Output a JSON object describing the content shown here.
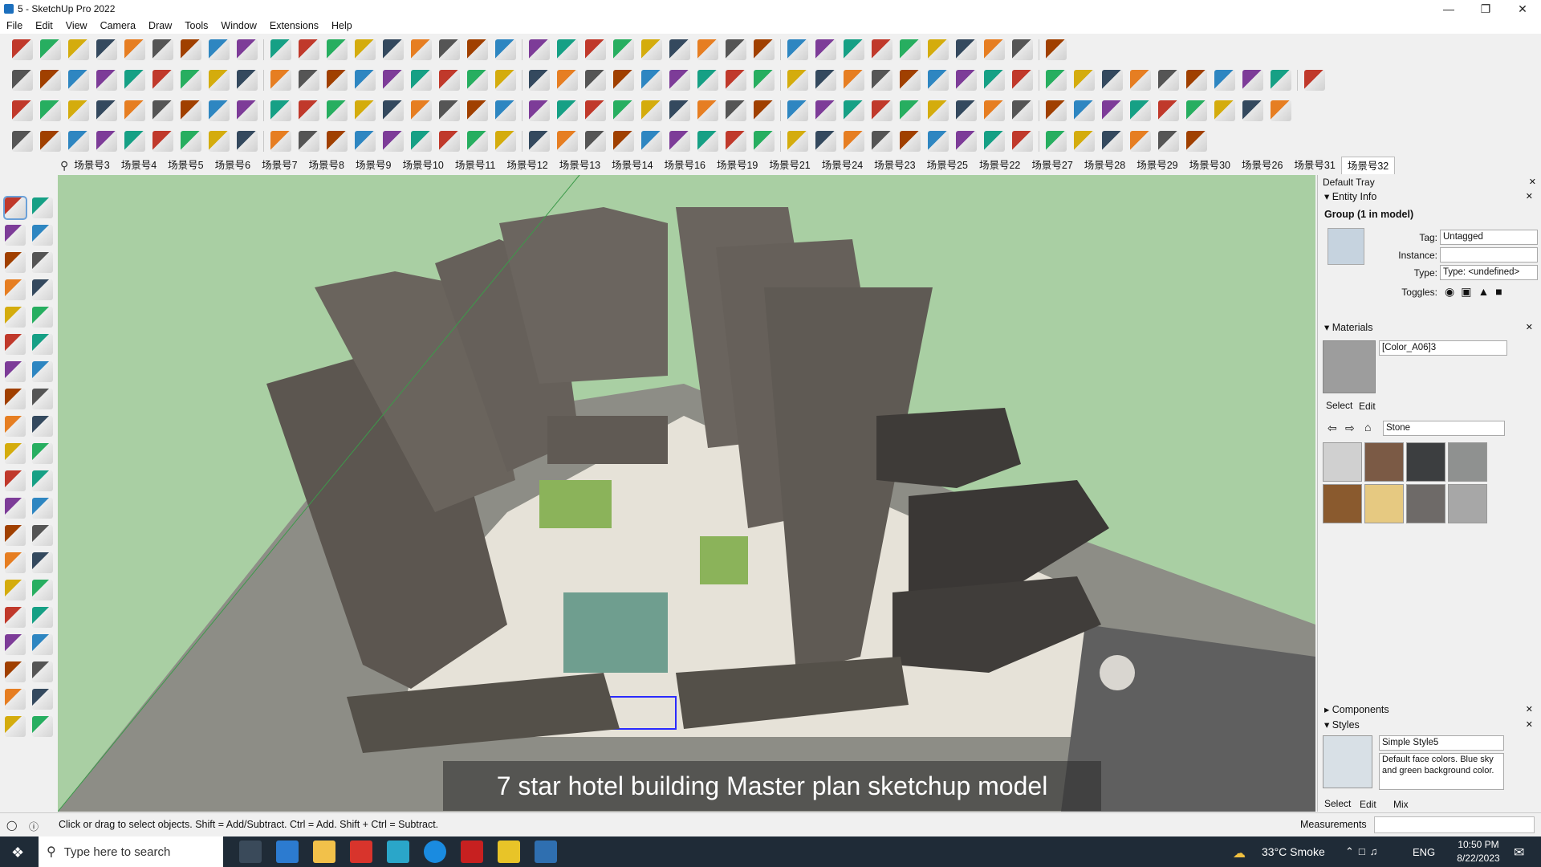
{
  "window": {
    "title": "5 - SketchUp Pro 2022",
    "controls": [
      "minimize-icon",
      "restore-icon",
      "close-icon"
    ]
  },
  "menu": [
    "File",
    "Edit",
    "View",
    "Camera",
    "Draw",
    "Tools",
    "Window",
    "Extensions",
    "Help"
  ],
  "scenes": {
    "tabs": [
      "场景号3",
      "场景号4",
      "场景号5",
      "场景号6",
      "场景号7",
      "场景号8",
      "场景号9",
      "场景号10",
      "场景号11",
      "场景号12",
      "场景号13",
      "场景号14",
      "场景号16",
      "场景号19",
      "场景号21",
      "场景号24",
      "场景号23",
      "场景号25",
      "场景号22",
      "场景号27",
      "场景号28",
      "场景号29",
      "场景号30",
      "场景号26",
      "场景号31",
      "场景号32"
    ],
    "active": "场景号32"
  },
  "viewport": {
    "caption": "7 star hotel building Master plan sketchup model",
    "background_color": "#a9cfa3"
  },
  "tray": {
    "title": "Default Tray",
    "entity_info": {
      "section": "Entity Info",
      "heading": "Group (1 in model)",
      "tag_label": "Tag:",
      "tag_value": "Untagged",
      "instance_label": "Instance:",
      "instance_value": "",
      "type_label": "Type:",
      "type_value": "Type: <undefined>",
      "toggles_label": "Toggles:"
    },
    "materials": {
      "section": "Materials",
      "name": "[Color_A06]3",
      "tabs": [
        "Select",
        "Edit"
      ],
      "library": "Stone",
      "swatch_colors": [
        "#d0d0d0",
        "#7b5a45",
        "#3c3e40",
        "#8f9190",
        "#8a5a2e",
        "#e6c981",
        "#6e6a68",
        "#a7a7a7"
      ]
    },
    "components": {
      "section": "Components"
    },
    "styles": {
      "section": "Styles",
      "name": "Simple Style5",
      "description": "Default face colors. Blue sky and green background color.",
      "tabs": [
        "Select",
        "Edit",
        "Mix"
      ]
    }
  },
  "status": {
    "message": "Click or drag to select objects. Shift = Add/Subtract. Ctrl = Add. Shift + Ctrl = Subtract.",
    "measurements_label": "Measurements"
  },
  "taskbar": {
    "search_placeholder": "Type here to search",
    "weather": "33°C  Smoke",
    "language": "ENG",
    "time": "10:50 PM",
    "date": "8/22/2023"
  }
}
